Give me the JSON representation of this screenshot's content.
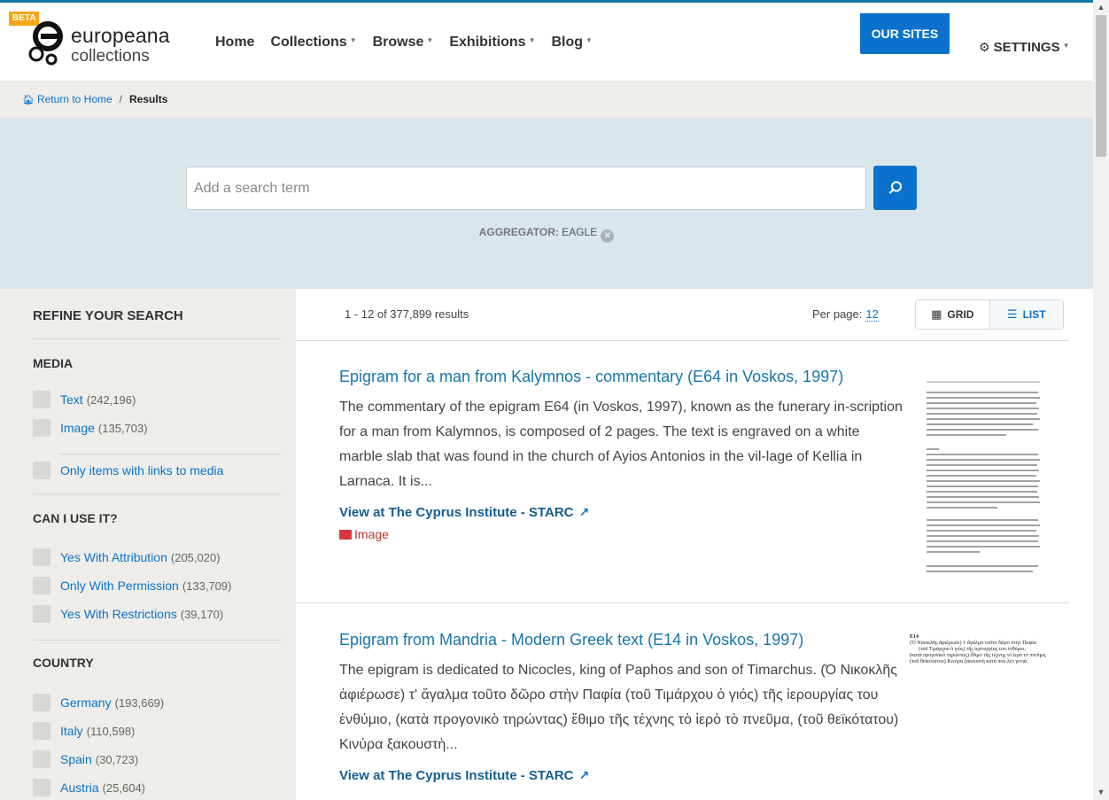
{
  "header": {
    "beta": "BETA",
    "logo_line1": "europeana",
    "logo_line2": "collections",
    "nav": [
      {
        "label": "Home",
        "dropdown": false
      },
      {
        "label": "Collections",
        "dropdown": true
      },
      {
        "label": "Browse",
        "dropdown": true
      },
      {
        "label": "Exhibitions",
        "dropdown": true
      },
      {
        "label": "Blog",
        "dropdown": true
      }
    ],
    "our_sites": "OUR SITES",
    "settings": "SETTINGS"
  },
  "breadcrumb": {
    "home": "Return to Home",
    "separator": "/",
    "current": "Results"
  },
  "search": {
    "placeholder": "Add a search term",
    "filter_key": "AGGREGATOR:",
    "filter_value": "EAGLE"
  },
  "sidebar": {
    "title": "REFINE YOUR SEARCH",
    "media": {
      "title": "MEDIA",
      "options": [
        {
          "label": "Text",
          "count": "(242,196)"
        },
        {
          "label": "Image",
          "count": "(135,703)"
        }
      ],
      "links_only": "Only items with links to media"
    },
    "rights": {
      "title": "CAN I USE IT?",
      "options": [
        {
          "label": "Yes With Attribution",
          "count": "(205,020)"
        },
        {
          "label": "Only With Permission",
          "count": "(133,709)"
        },
        {
          "label": "Yes With Restrictions",
          "count": "(39,170)"
        }
      ]
    },
    "country": {
      "title": "COUNTRY",
      "options": [
        {
          "label": "Germany",
          "count": "(193,669)"
        },
        {
          "label": "Italy",
          "count": "(110,598)"
        },
        {
          "label": "Spain",
          "count": "(30,723)"
        },
        {
          "label": "Austria",
          "count": "(25,604)"
        }
      ]
    }
  },
  "results": {
    "count": "1 - 12 of 377,899 results",
    "per_page_label": "Per page:",
    "per_page_value": "12",
    "view_grid": "GRID",
    "view_list": "LIST",
    "items": [
      {
        "title": "Epigram for a man from Kalymnos - commentary (E64 in Voskos, 1997)",
        "description": "The commentary of the epigram E64 (in Voskos, 1997), known as the funerary in-scription for a man from Kalymnos, is composed of 2 pages. The text is engraved on a white marble slab that was found in the church of Ayios Antonios in the vil-lage of Kellia in Larnaca. It is...",
        "link": "View at The Cyprus Institute - STARC",
        "type": "Image"
      },
      {
        "title": "Epigram from Mandria - Modern Greek text (E14 in Voskos, 1997)",
        "description": "The epigram is dedicated to Nicocles, king of Paphos and son of Timarchus. (Ό Νικοκλῆς ἀφιέρωσε) τ' ἄγαλμα τοῦτο δῶρο στὴν Παφία (τοῦ Τιμάρχου ὁ γιός) τῆς ἱερουργίας του ἐνθύμιο, (κατὰ προγονικὸ τηρώντας) ἔθιμο τῆς τέχνης τὸ ἱερὸ τὸ πνεῦμα, (τοῦ θεϊκότατου) Κινύρα ξακουστὴ...",
        "link": "View at The Cyprus Institute - STARC",
        "thumb_lines": [
          "E14",
          "(Ὁ Νικοκλῆς ἀφιέρωσε) τ' ἄγαλμα τοῦτο δῶρο στὴν Παφία",
          "(τοῦ Τιμάρχου ὁ γιός) τῆς ἱερουργίας του ἐνθύμιο,",
          "(κατὰ προγονικὸ τηρώντας) ἔθιμο τῆς τέχνης τὸ ἱερὸ τὸ πνεῦμα,",
          "(τοῦ θεϊκότατου) Κινύρα ξακουστὴ κατὰ ποὺ λὲν γενιά."
        ]
      }
    ]
  }
}
